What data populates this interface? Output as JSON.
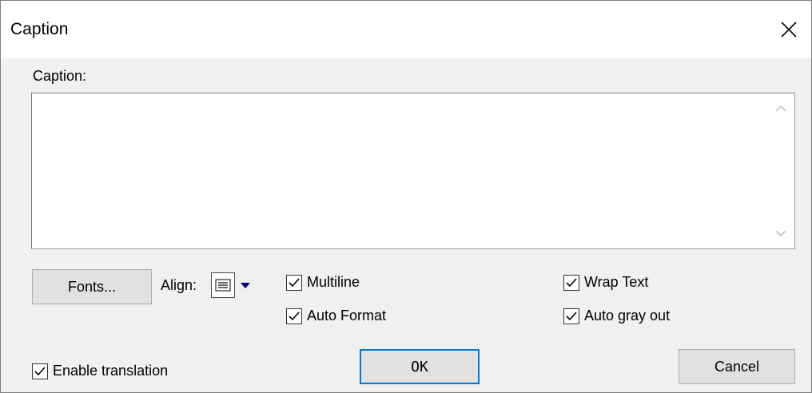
{
  "window": {
    "title": "Caption",
    "close_icon": "close-icon"
  },
  "caption": {
    "label": "Caption:",
    "value": ""
  },
  "buttons": {
    "fonts": "Fonts...",
    "ok": "OK",
    "cancel": "Cancel"
  },
  "align": {
    "label": "Align:",
    "selected_icon": "align-center-icon"
  },
  "checkboxes": {
    "multiline": {
      "label": "Multiline",
      "checked": true
    },
    "auto_format": {
      "label": "Auto Format",
      "checked": true
    },
    "wrap_text": {
      "label": "Wrap Text",
      "checked": true
    },
    "auto_gray_out": {
      "label": "Auto gray out",
      "checked": true
    },
    "enable_translation": {
      "label": "Enable translation",
      "checked": true
    }
  },
  "colors": {
    "default_button_border": "#0078d7",
    "dropdown_arrow": "#000080"
  }
}
